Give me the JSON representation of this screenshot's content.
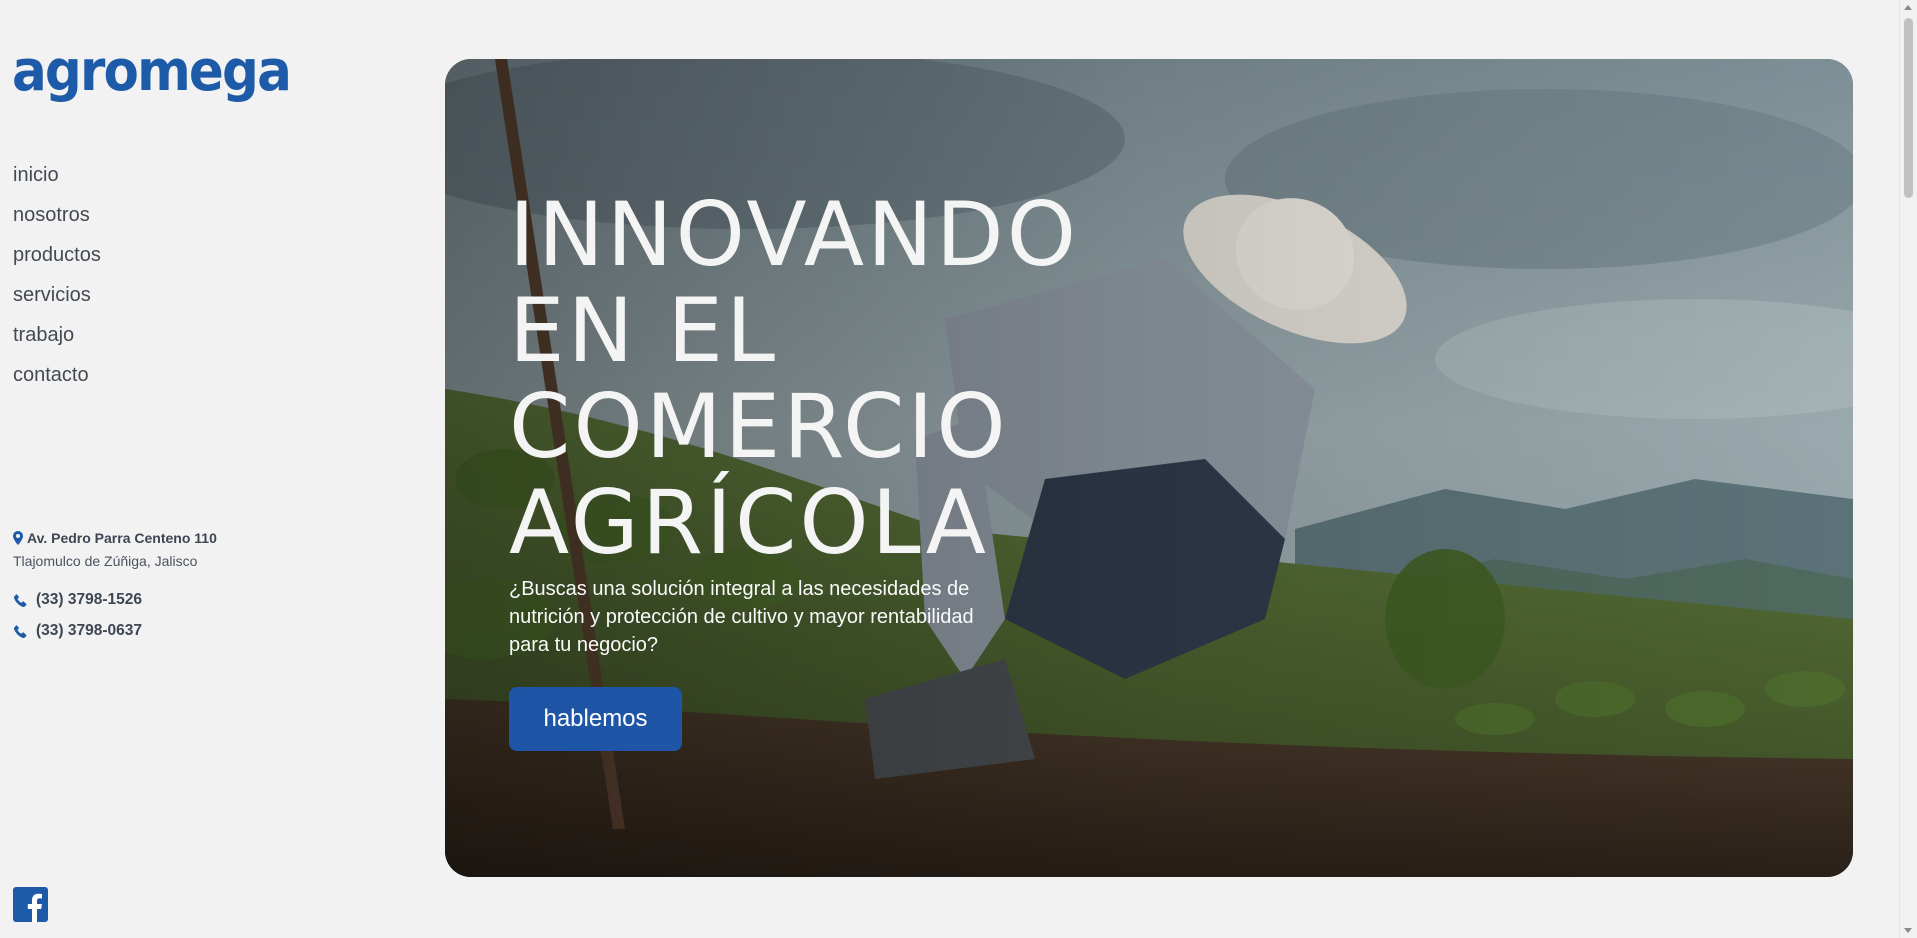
{
  "brand": {
    "logo_text": "agromega",
    "color": "#1d5aa7"
  },
  "nav": {
    "items": [
      {
        "label": "inicio"
      },
      {
        "label": "nosotros"
      },
      {
        "label": "productos"
      },
      {
        "label": "servicios"
      },
      {
        "label": "trabajo"
      },
      {
        "label": "contacto"
      }
    ]
  },
  "contact": {
    "address_line1": "Av. Pedro Parra Centeno 110",
    "address_line2": "Tlajomulco de Zúñiga, Jalisco",
    "phones": [
      "(33) 3798-1526",
      "(33) 3798-0637"
    ]
  },
  "social": {
    "facebook_icon": "facebook-icon"
  },
  "hero": {
    "headline_lines": [
      "INNOVANDO",
      "EN EL",
      "COMERCIO",
      "AGRÍCOLA"
    ],
    "subtitle": "¿Buscas una solución integral a las necesidades de nutrición y protección de cultivo y mayor rentabilidad para tu negocio?",
    "cta_label": "hablemos",
    "cta_color": "#1f55a6"
  }
}
